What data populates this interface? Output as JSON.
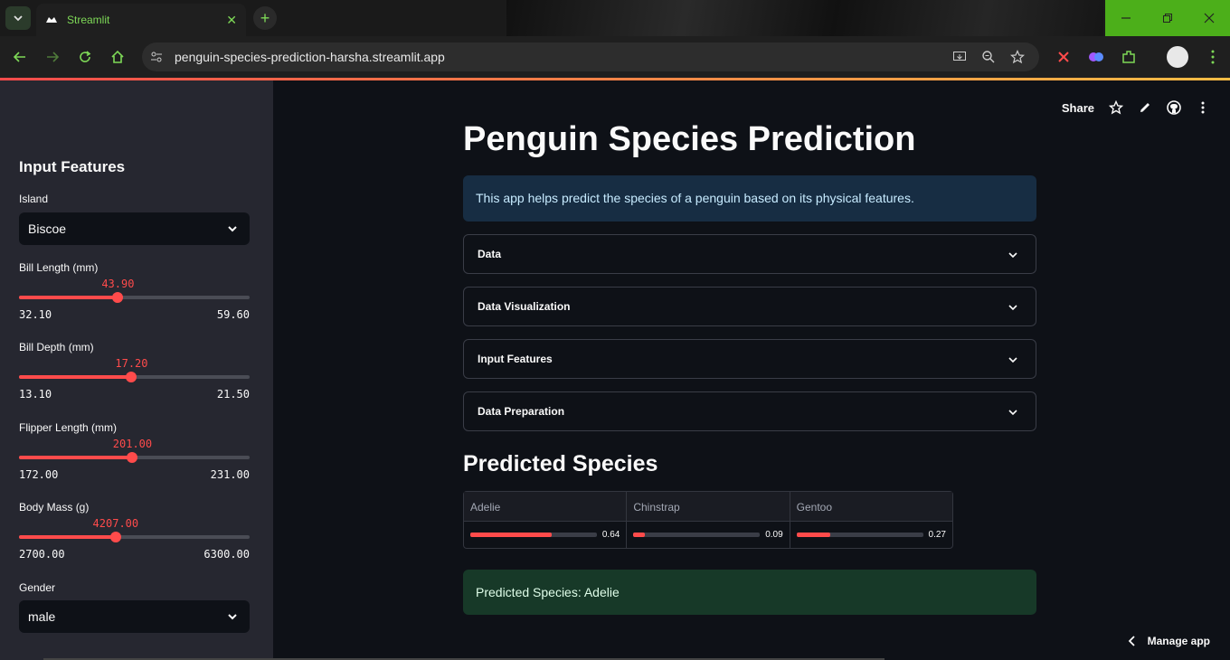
{
  "browser": {
    "tab_title": "Streamlit",
    "url": "penguin-species-prediction-harsha.streamlit.app"
  },
  "sidebar": {
    "title": "Input Features",
    "island": {
      "label": "Island",
      "value": "Biscoe"
    },
    "sliders": [
      {
        "label": "Bill Length (mm)",
        "value": "43.90",
        "min": "32.10",
        "max": "59.60",
        "fraction": 0.429
      },
      {
        "label": "Bill Depth (mm)",
        "value": "17.20",
        "min": "13.10",
        "max": "21.50",
        "fraction": 0.488
      },
      {
        "label": "Flipper Length (mm)",
        "value": "201.00",
        "min": "172.00",
        "max": "231.00",
        "fraction": 0.492
      },
      {
        "label": "Body Mass (g)",
        "value": "4207.00",
        "min": "2700.00",
        "max": "6300.00",
        "fraction": 0.419
      }
    ],
    "gender": {
      "label": "Gender",
      "value": "male"
    }
  },
  "header": {
    "share_label": "Share"
  },
  "main": {
    "title": "Penguin Species Prediction",
    "info": "This app helps predict the species of a penguin based on its physical features.",
    "expanders": [
      "Data",
      "Data Visualization",
      "Input Features",
      "Data Preparation"
    ],
    "predicted_heading": "Predicted Species",
    "probabilities": [
      {
        "species": "Adelie",
        "value": "0.64",
        "fraction": 0.64
      },
      {
        "species": "Chinstrap",
        "value": "0.09",
        "fraction": 0.09
      },
      {
        "species": "Gentoo",
        "value": "0.27",
        "fraction": 0.27
      }
    ],
    "result": "Predicted Species: Adelie"
  },
  "footer": {
    "manage_app": "Manage app"
  },
  "colors": {
    "accent": "#ff4b4b",
    "sidebar_bg": "#262730",
    "main_bg": "#0e1117",
    "info_bg": "#172d43",
    "success_bg": "#173928"
  }
}
